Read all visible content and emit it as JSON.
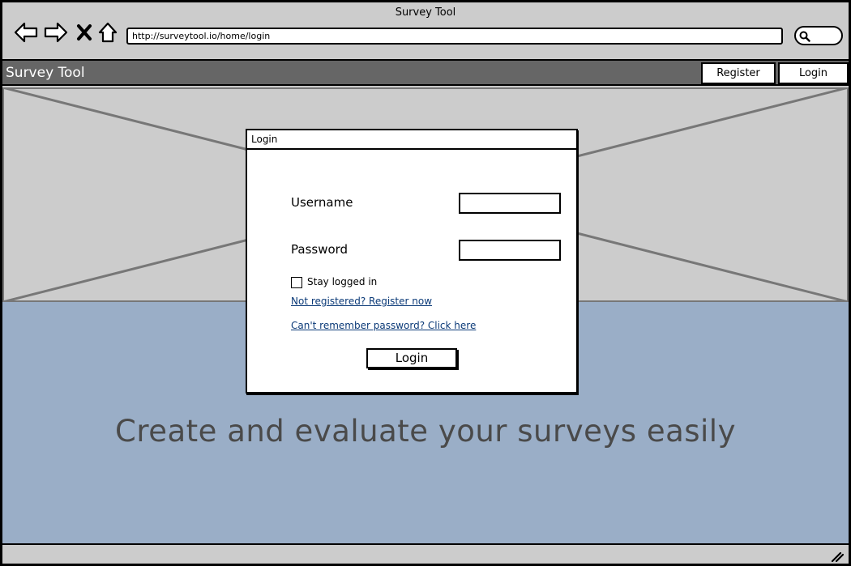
{
  "window": {
    "title": "Survey Tool"
  },
  "browser": {
    "url": "http://surveytool.io/home/login",
    "icons": [
      "back-arrow-icon",
      "forward-arrow-icon",
      "close-icon",
      "home-icon",
      "search-icon"
    ]
  },
  "header": {
    "title": "Survey Tool",
    "register_label": "Register",
    "login_label": "Login"
  },
  "dialog": {
    "title": "Login",
    "username_label": "Username",
    "username_value": "",
    "password_label": "Password",
    "password_value": "",
    "stay_logged_in_label": "Stay logged in",
    "stay_logged_in_checked": false,
    "register_link": "Not registered? Register now",
    "forgot_link": "Can't remember password? Click here",
    "submit_label": "Login"
  },
  "hero": {
    "tagline": "Create and evaluate your surveys easily"
  },
  "colors": {
    "header_bg": "#666666",
    "band_bg": "#9aaec7",
    "link": "#0b3a78"
  }
}
